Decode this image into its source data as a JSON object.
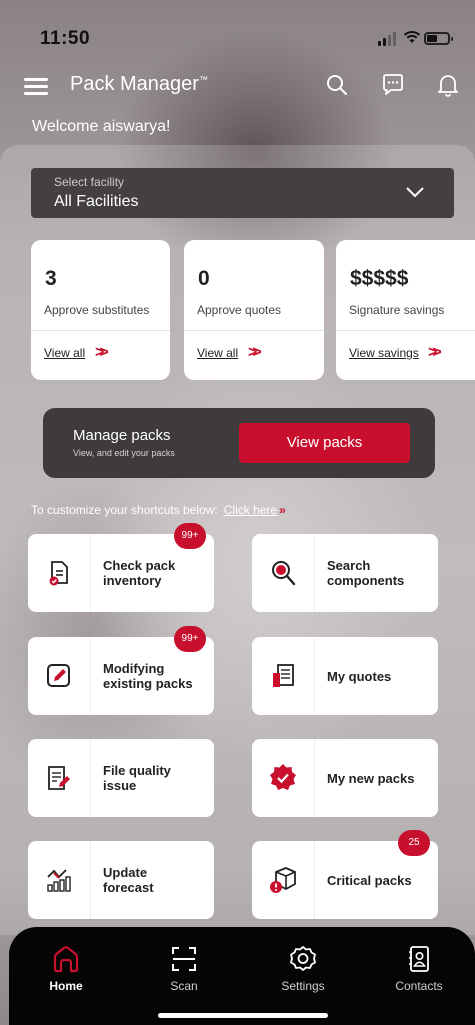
{
  "status_bar": {
    "time": "11:50"
  },
  "header": {
    "title": "Pack Manager",
    "trademark": "™"
  },
  "welcome": "Welcome aiswarya!",
  "facility": {
    "label": "Select facility",
    "value": "All Facilities"
  },
  "stats": [
    {
      "value": "3",
      "label": "Approve substitutes",
      "link": "View all"
    },
    {
      "value": "0",
      "label": "Approve quotes",
      "link": "View all"
    },
    {
      "value": "$$$$$",
      "label": "Signature savings",
      "link": "View savings"
    }
  ],
  "manage": {
    "title": "Manage packs",
    "subtitle": "View, and edit your packs",
    "button": "View packs"
  },
  "customize": {
    "text": "To customize your shortcuts below:",
    "link": "Click here"
  },
  "shortcuts": [
    {
      "line1": "Check pack",
      "line2": "inventory",
      "icon": "pack-inventory-icon",
      "badge": "99+"
    },
    {
      "line1": "Search",
      "line2": "components",
      "icon": "search-components-icon",
      "badge": ""
    },
    {
      "line1": "Modifying",
      "line2": "existing packs",
      "icon": "edit-pack-icon",
      "badge": "99+"
    },
    {
      "line1": "My quotes",
      "line2": "",
      "icon": "quotes-icon",
      "badge": ""
    },
    {
      "line1": "File quality",
      "line2": "issue",
      "icon": "quality-issue-icon",
      "badge": ""
    },
    {
      "line1": "My new packs",
      "line2": "",
      "icon": "new-packs-icon",
      "badge": ""
    },
    {
      "line1": "Update",
      "line2": "forecast",
      "icon": "forecast-icon",
      "badge": ""
    },
    {
      "line1": "Critical packs",
      "line2": "",
      "icon": "critical-packs-icon",
      "badge": "25"
    }
  ],
  "nav": [
    {
      "label": "Home",
      "icon": "home-icon",
      "active": true
    },
    {
      "label": "Scan",
      "icon": "scan-icon",
      "active": false
    },
    {
      "label": "Settings",
      "icon": "settings-icon",
      "active": false
    },
    {
      "label": "Contacts",
      "icon": "contacts-icon",
      "active": false
    }
  ],
  "colors": {
    "accent": "#c8102e",
    "dark_panel": "#3f3b3c",
    "nav_bg": "#050505"
  }
}
